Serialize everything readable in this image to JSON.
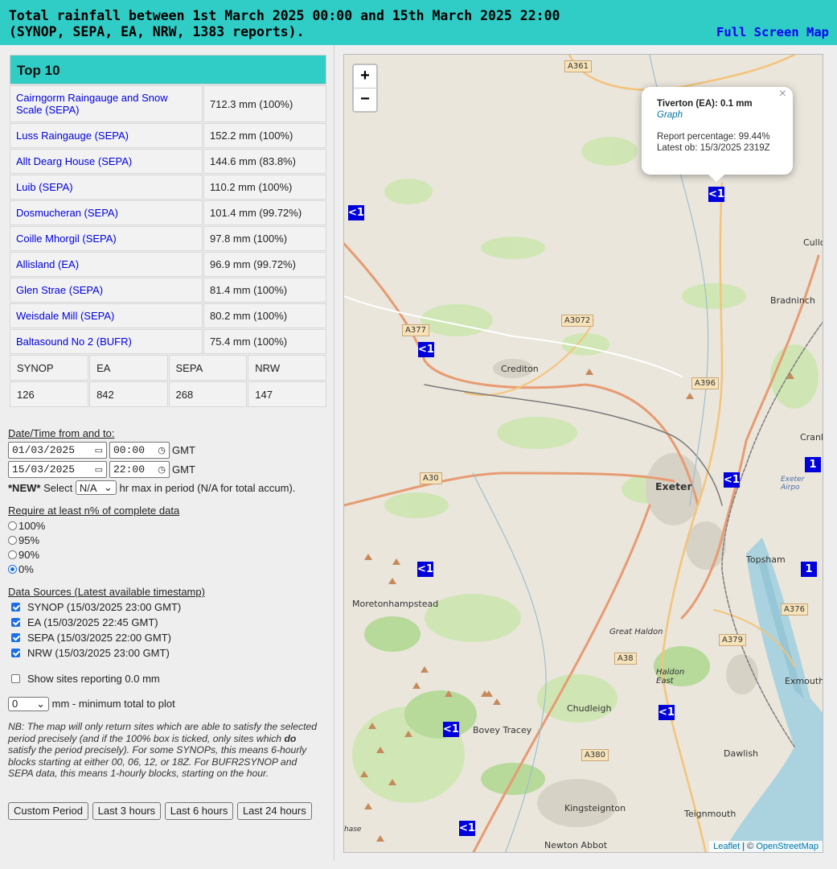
{
  "header": {
    "title_line1": "Total rainfall between 1st March 2025 00:00 and 15th March 2025 22:00",
    "title_line2": "(SYNOP, SEPA, EA, NRW, 1383 reports).",
    "fullscreen_link": "Full Screen Map"
  },
  "top10": {
    "heading": "Top 10",
    "rows": [
      {
        "name": "Cairngorm Raingauge and Snow Scale (SEPA)",
        "value": "712.3 mm (100%)"
      },
      {
        "name": "Luss Raingauge (SEPA)",
        "value": "152.2 mm (100%)"
      },
      {
        "name": "Allt Dearg House (SEPA)",
        "value": "144.6 mm (83.8%)"
      },
      {
        "name": "Luib (SEPA)",
        "value": "110.2 mm (100%)"
      },
      {
        "name": "Dosmucheran (SEPA)",
        "value": "101.4 mm (99.72%)"
      },
      {
        "name": "Coille Mhorgil (SEPA)",
        "value": "97.8 mm (100%)"
      },
      {
        "name": "Allisland (EA)",
        "value": "96.9 mm (99.72%)"
      },
      {
        "name": "Glen Strae (SEPA)",
        "value": "81.4 mm (100%)"
      },
      {
        "name": "Weisdale Mill (SEPA)",
        "value": "80.2 mm (100%)"
      },
      {
        "name": "Baltasound No 2 (BUFR)",
        "value": "75.4 mm (100%)"
      }
    ],
    "count_headers": [
      "SYNOP",
      "EA",
      "SEPA",
      "NRW"
    ],
    "count_values": [
      "126",
      "842",
      "268",
      "147"
    ]
  },
  "form": {
    "datetime_label": "Date/Time from and to:",
    "from_date": "01/03/2025",
    "from_time": "00:00",
    "to_date": "15/03/2025",
    "to_time": "22:00",
    "tz": "GMT",
    "new_tag": "*NEW*",
    "select_word": "Select",
    "hrmax_value": "N/A",
    "hrmax_text": "hr max in period (N/A for total accum).",
    "require_label": "Require at least n% of complete data",
    "pct_options": [
      "100%",
      "95%",
      "90%",
      "0%"
    ],
    "pct_selected": "0%",
    "sources_label": "Data Sources (Latest available timestamp)",
    "sources": [
      {
        "label": "SYNOP (15/03/2025 23:00 GMT)",
        "checked": true
      },
      {
        "label": "EA (15/03/2025 22:45 GMT)",
        "checked": true
      },
      {
        "label": "SEPA (15/03/2025 22:00 GMT)",
        "checked": true
      },
      {
        "label": "NRW (15/03/2025 23:00 GMT)",
        "checked": true
      }
    ],
    "show_zero_label": "Show sites reporting 0.0 mm",
    "show_zero_checked": false,
    "min_total_value": "0",
    "min_total_text": "mm - minimum total to plot",
    "note_pre": "NB: The map will only return sites which are able to satisfy the selected period precisely (and if the 100% box is ticked, only sites which ",
    "note_bold": "do",
    "note_post": " satisfy the period precisely). For some SYNOPs, this means 6-hourly blocks starting at either 00, 06, 12, or 18Z. For BUFR2SYNOP and SEPA data, this means 1-hourly blocks, starting on the hour.",
    "buttons": [
      "Custom Period",
      "Last 3 hours",
      "Last 6 hours",
      "Last 24 hours"
    ]
  },
  "map": {
    "zoom_in": "+",
    "zoom_out": "−",
    "markers": [
      "<1",
      "<1",
      "<1",
      "<1",
      "1",
      "1",
      "<1",
      "<1",
      "<1",
      "<1"
    ],
    "popup": {
      "title": "Tiverton (EA): 0.1 mm",
      "graph_link": "Graph",
      "report_pct": "Report percentage: 99.44%",
      "latest_ob": "Latest ob: 15/3/2025 2319Z",
      "close": "×"
    },
    "places": [
      "Crediton",
      "Exeter",
      "Topsham",
      "Bradninch",
      "Moretonhampstead",
      "Great Haldon",
      "Haldon East",
      "Exmouth",
      "Chudleigh",
      "Bovey Tracey",
      "Dawlish",
      "Kingsteignton",
      "Teignmouth",
      "Newton Abbot",
      "Exeter Airpo",
      "Crank",
      "Cullo",
      "hase"
    ],
    "roads": [
      "A361",
      "A3072",
      "A377",
      "A396",
      "A30",
      "A376",
      "A379",
      "A38",
      "A380"
    ],
    "attribution_link1": "Leaflet",
    "attribution_sep": " | © ",
    "attribution_link2": "OpenStreetMap"
  },
  "colors": {
    "accent": "#2fcdc6",
    "link": "#0000dd",
    "marker": "#0000dd"
  }
}
